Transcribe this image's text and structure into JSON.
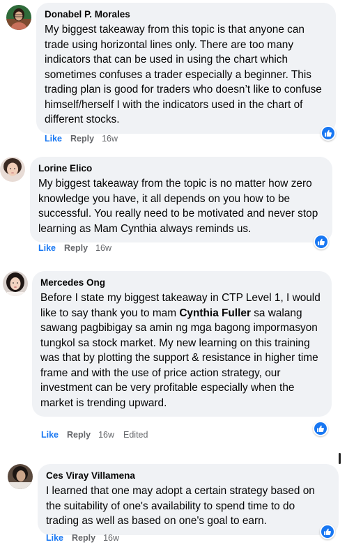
{
  "comments": [
    {
      "author": "Donabel P. Morales",
      "text_parts": [
        {
          "text": "My biggest takeaway from this topic is that anyone can trade using horizontal lines only. There are too many indicators that can be used in using the chart which sometimes confuses a trader especially a beginner. This trading plan is good for traders who doesn’t like to confuse himself/herself I with the indicators used in the chart of different stocks."
        }
      ],
      "like_label": "Like",
      "reply_label": "Reply",
      "time": "16w",
      "reaction_icon": "like-reaction-icon"
    },
    {
      "author": "Lorine Elico",
      "text_parts": [
        {
          "text": "My biggest takeaway from the topic is no matter how zero knowledge you have, it all depends on you how to be successful. You really need to be motivated and never stop learning as Mam Cynthia always reminds us."
        }
      ],
      "like_label": "Like",
      "reply_label": "Reply",
      "time": "16w",
      "reaction_icon": "like-reaction-icon"
    },
    {
      "author": "Mercedes Ong",
      "text_parts": [
        {
          "text": "Before I state my biggest takeaway in CTP Level 1, I would like to say thank you to mam "
        },
        {
          "text": "Cynthia Fuller",
          "bold": true
        },
        {
          "text": " sa walang sawang pagbibigay sa amin ng mga bagong impormasyon tungkol sa stock market. My new learning on this training was that by plotting the support & resistance in higher time frame and with the use of price action strategy, our investment can be very profitable especially when the market is trending upward."
        }
      ],
      "like_label": "Like",
      "reply_label": "Reply",
      "time": "16w",
      "edited_label": "Edited",
      "reaction_icon": "like-reaction-icon"
    },
    {
      "author": "Ces Viray Villamena",
      "text_parts": [
        {
          "text": "I learned that one may adopt a certain strategy based on the suitability of one's availability to spend time to do trading as well as based on one's goal to earn."
        }
      ],
      "like_label": "Like",
      "reply_label": "Reply",
      "time": "16w",
      "reaction_icon": "like-reaction-icon"
    }
  ],
  "colors": {
    "bubble": "#f0f2f5",
    "like_blue": "#1877f2",
    "meta_gray": "#65676b",
    "text": "#050505"
  }
}
